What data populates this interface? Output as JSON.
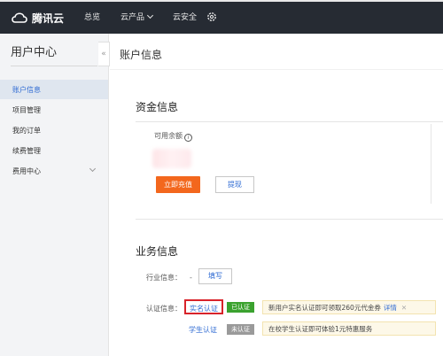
{
  "topbar": {
    "brand": "腾讯云",
    "nav": [
      "总览",
      "云产品",
      "云安全"
    ]
  },
  "sidebar": {
    "title": "用户中心",
    "items": [
      {
        "label": "账户信息",
        "active": true
      },
      {
        "label": "项目管理",
        "active": false
      },
      {
        "label": "我的订单",
        "active": false
      },
      {
        "label": "续费管理",
        "active": false
      },
      {
        "label": "费用中心",
        "active": false
      }
    ]
  },
  "main": {
    "title": "账户信息",
    "fund": {
      "title": "资金信息",
      "balance_label": "可用余额",
      "recharge_button": "立即充值",
      "withdraw_button": "提现"
    },
    "business": {
      "title": "业务信息",
      "industry_label": "行业信息：",
      "industry_value": "-",
      "fill_button": "填写",
      "cert_label": "认证信息：",
      "realname_link": "实名认证",
      "realname_status": "已认证",
      "realname_notice": "新用户实名认证即可领取260元代金券",
      "realname_notice_link": "详情",
      "student_link": "学生认证",
      "student_status": "未认证",
      "student_notice": "在校学生认证即可体验1元特惠服务"
    }
  },
  "colors": {
    "topbar": "#262b33",
    "primary_button": "#f3671d",
    "link": "#2f6bd3",
    "verified": "#3ba22f",
    "unverified": "#9a9a9a",
    "highlight_box": "#d8232a"
  }
}
